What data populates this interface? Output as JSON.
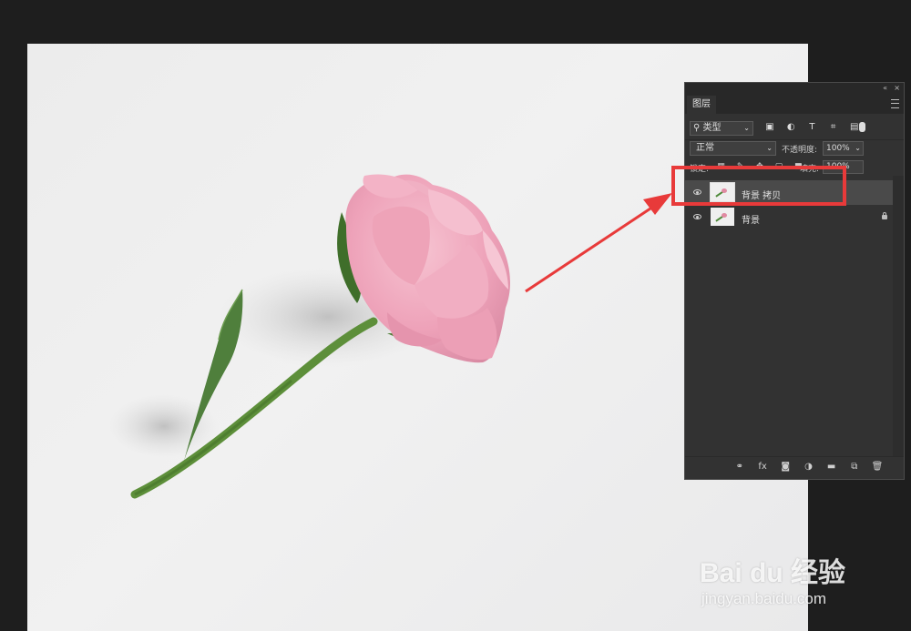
{
  "layers_panel": {
    "collapse_icon": "«",
    "close_icon": "×",
    "tab_label": "图层",
    "filter": {
      "kind_label": "类型",
      "icons": [
        "image-filter-icon",
        "adjustment-filter-icon",
        "type-filter-icon",
        "shape-filter-icon",
        "smart-object-filter-icon"
      ],
      "type_glyph": "T"
    },
    "blend_mode": "正常",
    "opacity_label": "不透明度:",
    "opacity_value": "100%",
    "lock_label": "锁定:",
    "fill_label": "填充:",
    "fill_value": "100%",
    "layers": [
      {
        "name": "背景 拷贝",
        "selected": true,
        "visible": true,
        "locked": false
      },
      {
        "name": "背景",
        "selected": false,
        "visible": true,
        "locked": true
      }
    ],
    "bottom_icons": [
      "link-icon",
      "fx-icon",
      "mask-icon",
      "adjustment-icon",
      "group-icon",
      "new-layer-icon",
      "delete-icon"
    ],
    "fx_label": "fx"
  },
  "annotation": {
    "color": "#e83a3a"
  },
  "watermark": {
    "logo_text": "Bai du 经验",
    "url": "jingyan.baidu.com"
  },
  "colors": {
    "accent": "#e83a3a",
    "panel_bg": "#323232",
    "app_bg": "#1e1e1e"
  }
}
